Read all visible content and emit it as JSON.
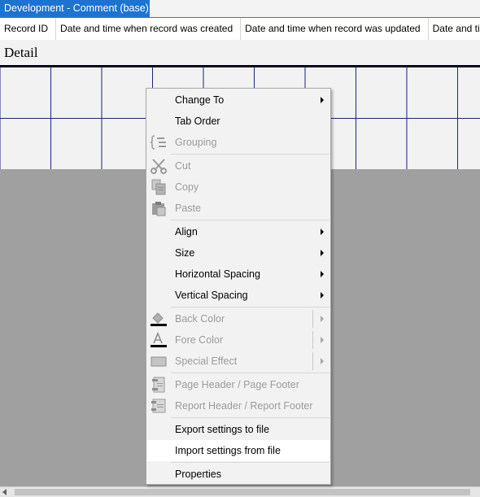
{
  "window": {
    "title": "Development - Comment (base)"
  },
  "header_columns": [
    "Record ID",
    "Date and time when record was created",
    "Date and time when record was updated",
    "Date and ti"
  ],
  "section": {
    "title": "Detail"
  },
  "context_menu": {
    "change_to": "Change To",
    "tab_order": "Tab Order",
    "grouping": "Grouping",
    "cut": "Cut",
    "copy": "Copy",
    "paste": "Paste",
    "align": "Align",
    "size": "Size",
    "horizontal_spacing": "Horizontal Spacing",
    "vertical_spacing": "Vertical Spacing",
    "back_color": "Back Color",
    "fore_color": "Fore Color",
    "special_effect": "Special Effect",
    "page_header_footer": "Page Header / Page Footer",
    "report_header_footer": "Report Header / Report Footer",
    "export_settings": "Export settings to file",
    "import_settings": "Import settings from file",
    "properties": "Properties"
  },
  "colors": {
    "title_tab": "#1e73d0",
    "grid_lines": "#1a237e",
    "canvas": "#a0a0a0"
  }
}
